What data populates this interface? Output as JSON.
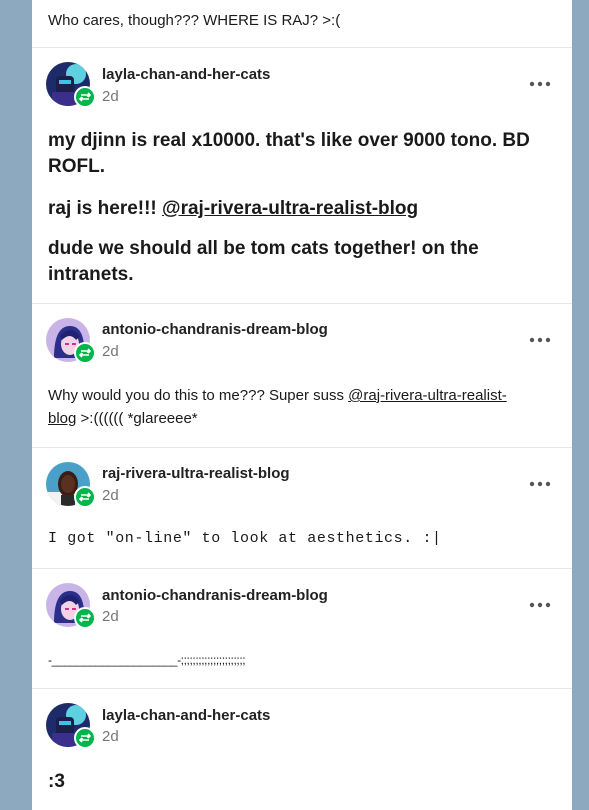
{
  "top_snippet": {
    "text": "Who cares, though??? WHERE IS RAJ? >:("
  },
  "posts": [
    {
      "username": "layla-chan-and-her-cats",
      "time": "2d",
      "lines": [
        "my djinn is real x10000. that's like over 9000 tono. BD ROFL.",
        "dude we should all be tom cats together! on the intranets."
      ],
      "mention_prefix": "raj is here!!! ",
      "mention": "@raj-rivera-ultra-realist-blog"
    },
    {
      "username": "antonio-chandranis-dream-blog",
      "time": "2d",
      "text_before": "Why would you do this to me??? Super suss ",
      "mention_part1": "@raj-rivera-ultra-realist-",
      "mention_part2": "blog",
      "text_after": " >:(((((( *glareeee*"
    },
    {
      "username": "raj-rivera-ultra-realist-blog",
      "time": "2d",
      "text": "I got \"on-line\" to look at aesthetics. :|"
    },
    {
      "username": "antonio-chandranis-dream-blog",
      "time": "2d",
      "text": "-____________________-;;;;;;;;;;;;;;;;;;;;;;"
    },
    {
      "username": "layla-chan-and-her-cats",
      "time": "2d",
      "text": ":3"
    }
  ],
  "icons": {
    "reblog_badge": "reblog-icon",
    "more": "more-options-icon"
  },
  "colors": {
    "background": "#8da9c0",
    "reblog_badge": "#00b54b"
  }
}
